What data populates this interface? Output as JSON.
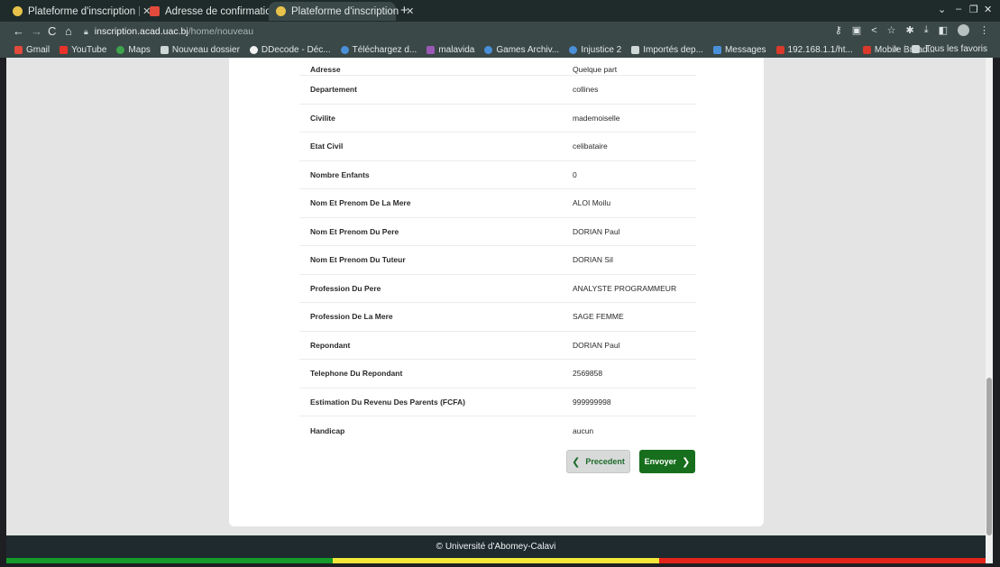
{
  "browser": {
    "tabs": [
      {
        "label": "Plateforme d'inscription",
        "active": false,
        "favicon_color": "#e8c24a"
      },
      {
        "label": "Adresse de confirmation",
        "active": false,
        "favicon_color": "#e24a3b"
      },
      {
        "label": "Plateforme d'inscription",
        "active": true,
        "favicon_color": "#e8c24a"
      }
    ],
    "new_tab": "+",
    "url_host": "inscription.acad.uac.bj",
    "url_path": "/home/nouveau",
    "bookmarks": [
      {
        "label": "Gmail",
        "color": "#e24a3b"
      },
      {
        "label": "YouTube",
        "color": "#e8322a"
      },
      {
        "label": "Maps",
        "color": "#3fa34d"
      },
      {
        "label": "Nouveau dossier",
        "color": "#cfd8d6"
      },
      {
        "label": "DDecode - Déc...",
        "color": "#f2f2f2"
      },
      {
        "label": "Téléchargez d...",
        "color": "#4a90d9"
      },
      {
        "label": "malavida",
        "color": "#9b59b6"
      },
      {
        "label": "Games Archiv...",
        "color": "#4a90d9"
      },
      {
        "label": "Injustice 2",
        "color": "#4a90d9"
      },
      {
        "label": "Importés dep...",
        "color": "#cfd8d6"
      },
      {
        "label": "Messages",
        "color": "#4a90d9"
      },
      {
        "label": "192.168.1.1/ht...",
        "color": "#d93a2b"
      },
      {
        "label": "Mobile Broad...",
        "color": "#d93a2b"
      }
    ],
    "bookmarks_more": "»",
    "all_favorites": "Tous les favoris"
  },
  "form": {
    "partial_row": {
      "label": "Adresse",
      "value": "Quelque part"
    },
    "rows": [
      {
        "label": "Departement",
        "value": "collines"
      },
      {
        "label": "Civilite",
        "value": "mademoiselle"
      },
      {
        "label": "Etat Civil",
        "value": "celibataire"
      },
      {
        "label": "Nombre Enfants",
        "value": "0"
      },
      {
        "label": "Nom Et Prenom De La Mere",
        "value": "ALOI Moilu"
      },
      {
        "label": "Nom Et Prenom Du Pere",
        "value": "DORIAN Paul"
      },
      {
        "label": "Nom Et Prenom Du Tuteur",
        "value": "DORIAN Sil"
      },
      {
        "label": "Profession Du Pere",
        "value": "ANALYSTE PROGRAMMEUR"
      },
      {
        "label": "Profession De La Mere",
        "value": "SAGE FEMME"
      },
      {
        "label": "Repondant",
        "value": "DORIAN Paul"
      },
      {
        "label": "Telephone Du Repondant",
        "value": "2569858"
      },
      {
        "label": "Estimation Du Revenu Des Parents (FCFA)",
        "value": "999999998"
      },
      {
        "label": "Handicap",
        "value": "aucun"
      }
    ],
    "prev_label": "Precedent",
    "next_label": "Envoyer"
  },
  "footer": {
    "text": "© Université d'Abomey-Calavi"
  },
  "colors": {
    "accent_green": "#176e1c",
    "flag_green": "#159a2b",
    "flag_yellow": "#f3e83a",
    "flag_red": "#e3241b"
  }
}
